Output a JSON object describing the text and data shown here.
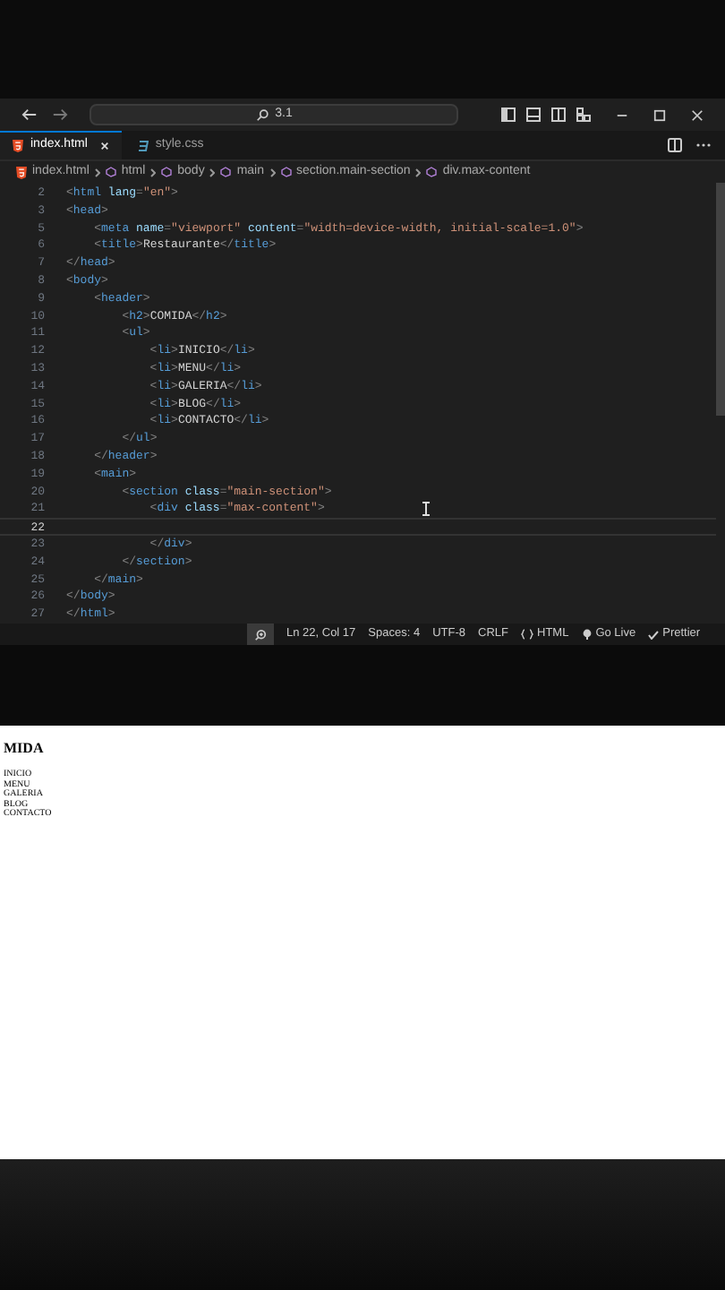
{
  "title_bar": {
    "search": "3.1"
  },
  "tabs": [
    {
      "label": "index.html",
      "kind": "html",
      "selected": true
    },
    {
      "label": "style.css",
      "kind": "css",
      "selected": false
    }
  ],
  "breadcrumb": [
    {
      "label": "index.html",
      "kind": "file"
    },
    {
      "label": "html",
      "kind": "element"
    },
    {
      "label": "body",
      "kind": "element"
    },
    {
      "label": "main",
      "kind": "element"
    },
    {
      "label": "section.main-section",
      "kind": "element"
    },
    {
      "label": "div.max-content",
      "kind": "element"
    }
  ],
  "code_lines": [
    {
      "number": "2",
      "current": false,
      "tokens": [
        {
          "kind": "punct",
          "text": "<"
        },
        {
          "kind": "tag",
          "text": "html"
        },
        {
          "kind": "attr",
          "text": " lang"
        },
        {
          "kind": "punct",
          "text": "="
        },
        {
          "kind": "str",
          "text": "\"en\""
        },
        {
          "kind": "punct",
          "text": ">"
        }
      ]
    },
    {
      "number": "3",
      "current": false,
      "tokens": [
        {
          "kind": "punct",
          "text": "<"
        },
        {
          "kind": "tag",
          "text": "head"
        },
        {
          "kind": "punct",
          "text": ">"
        }
      ]
    },
    {
      "number": "5",
      "current": false,
      "tokens": [
        {
          "kind": "punct",
          "text": "    <"
        },
        {
          "kind": "tag",
          "text": "meta"
        },
        {
          "kind": "attr",
          "text": " name"
        },
        {
          "kind": "punct",
          "text": "="
        },
        {
          "kind": "str",
          "text": "\"viewport\""
        },
        {
          "kind": "attr",
          "text": " content"
        },
        {
          "kind": "punct",
          "text": "="
        },
        {
          "kind": "str",
          "text": "\"width=device-width, initial-scale=1.0\""
        },
        {
          "kind": "punct",
          "text": ">"
        }
      ]
    },
    {
      "number": "6",
      "current": false,
      "tokens": [
        {
          "kind": "punct",
          "text": "    <"
        },
        {
          "kind": "tag",
          "text": "title"
        },
        {
          "kind": "punct",
          "text": ">"
        },
        {
          "kind": "text",
          "text": "Restaurante"
        },
        {
          "kind": "punct",
          "text": "</"
        },
        {
          "kind": "tag",
          "text": "title"
        },
        {
          "kind": "punct",
          "text": ">"
        }
      ]
    },
    {
      "number": "7",
      "current": false,
      "tokens": [
        {
          "kind": "punct",
          "text": "</"
        },
        {
          "kind": "tag",
          "text": "head"
        },
        {
          "kind": "punct",
          "text": ">"
        }
      ]
    },
    {
      "number": "8",
      "current": false,
      "tokens": [
        {
          "kind": "punct",
          "text": "<"
        },
        {
          "kind": "tag",
          "text": "body"
        },
        {
          "kind": "punct",
          "text": ">"
        }
      ]
    },
    {
      "number": "9",
      "current": false,
      "tokens": [
        {
          "kind": "punct",
          "text": "    <"
        },
        {
          "kind": "tag",
          "text": "header"
        },
        {
          "kind": "punct",
          "text": ">"
        }
      ]
    },
    {
      "number": "10",
      "current": false,
      "tokens": [
        {
          "kind": "punct",
          "text": "        <"
        },
        {
          "kind": "tag",
          "text": "h2"
        },
        {
          "kind": "punct",
          "text": ">"
        },
        {
          "kind": "text",
          "text": "COMIDA"
        },
        {
          "kind": "punct",
          "text": "</"
        },
        {
          "kind": "tag",
          "text": "h2"
        },
        {
          "kind": "punct",
          "text": ">"
        }
      ]
    },
    {
      "number": "11",
      "current": false,
      "tokens": [
        {
          "kind": "punct",
          "text": "        <"
        },
        {
          "kind": "tag",
          "text": "ul"
        },
        {
          "kind": "punct",
          "text": ">"
        }
      ]
    },
    {
      "number": "12",
      "current": false,
      "tokens": [
        {
          "kind": "punct",
          "text": "            <"
        },
        {
          "kind": "tag",
          "text": "li"
        },
        {
          "kind": "punct",
          "text": ">"
        },
        {
          "kind": "text",
          "text": "INICIO"
        },
        {
          "kind": "punct",
          "text": "</"
        },
        {
          "kind": "tag",
          "text": "li"
        },
        {
          "kind": "punct",
          "text": ">"
        }
      ]
    },
    {
      "number": "13",
      "current": false,
      "tokens": [
        {
          "kind": "punct",
          "text": "            <"
        },
        {
          "kind": "tag",
          "text": "li"
        },
        {
          "kind": "punct",
          "text": ">"
        },
        {
          "kind": "text",
          "text": "MENU"
        },
        {
          "kind": "punct",
          "text": "</"
        },
        {
          "kind": "tag",
          "text": "li"
        },
        {
          "kind": "punct",
          "text": ">"
        }
      ]
    },
    {
      "number": "14",
      "current": false,
      "tokens": [
        {
          "kind": "punct",
          "text": "            <"
        },
        {
          "kind": "tag",
          "text": "li"
        },
        {
          "kind": "punct",
          "text": ">"
        },
        {
          "kind": "text",
          "text": "GALERIA"
        },
        {
          "kind": "punct",
          "text": "</"
        },
        {
          "kind": "tag",
          "text": "li"
        },
        {
          "kind": "punct",
          "text": ">"
        }
      ]
    },
    {
      "number": "15",
      "current": false,
      "tokens": [
        {
          "kind": "punct",
          "text": "            <"
        },
        {
          "kind": "tag",
          "text": "li"
        },
        {
          "kind": "punct",
          "text": ">"
        },
        {
          "kind": "text",
          "text": "BLOG"
        },
        {
          "kind": "punct",
          "text": "</"
        },
        {
          "kind": "tag",
          "text": "li"
        },
        {
          "kind": "punct",
          "text": ">"
        }
      ]
    },
    {
      "number": "16",
      "current": false,
      "tokens": [
        {
          "kind": "punct",
          "text": "            <"
        },
        {
          "kind": "tag",
          "text": "li"
        },
        {
          "kind": "punct",
          "text": ">"
        },
        {
          "kind": "text",
          "text": "CONTACTO"
        },
        {
          "kind": "punct",
          "text": "</"
        },
        {
          "kind": "tag",
          "text": "li"
        },
        {
          "kind": "punct",
          "text": ">"
        }
      ]
    },
    {
      "number": "17",
      "current": false,
      "tokens": [
        {
          "kind": "punct",
          "text": "        </"
        },
        {
          "kind": "tag",
          "text": "ul"
        },
        {
          "kind": "punct",
          "text": ">"
        }
      ]
    },
    {
      "number": "18",
      "current": false,
      "tokens": [
        {
          "kind": "punct",
          "text": "    </"
        },
        {
          "kind": "tag",
          "text": "header"
        },
        {
          "kind": "punct",
          "text": ">"
        }
      ]
    },
    {
      "number": "19",
      "current": false,
      "tokens": [
        {
          "kind": "punct",
          "text": "    <"
        },
        {
          "kind": "tag",
          "text": "main"
        },
        {
          "kind": "punct",
          "text": ">"
        }
      ]
    },
    {
      "number": "20",
      "current": false,
      "tokens": [
        {
          "kind": "punct",
          "text": "        <"
        },
        {
          "kind": "tag",
          "text": "section"
        },
        {
          "kind": "attr",
          "text": " class"
        },
        {
          "kind": "punct",
          "text": "="
        },
        {
          "kind": "str",
          "text": "\"main-section\""
        },
        {
          "kind": "punct",
          "text": ">"
        }
      ]
    },
    {
      "number": "21",
      "current": false,
      "tokens": [
        {
          "kind": "punct",
          "text": "            <"
        },
        {
          "kind": "tag",
          "text": "div"
        },
        {
          "kind": "attr",
          "text": " class"
        },
        {
          "kind": "punct",
          "text": "="
        },
        {
          "kind": "str",
          "text": "\"max-content\""
        },
        {
          "kind": "punct",
          "text": ">"
        }
      ]
    },
    {
      "number": "22",
      "current": true
    },
    {
      "number": "23",
      "current": false,
      "tokens": [
        {
          "kind": "punct",
          "text": "            </"
        },
        {
          "kind": "tag",
          "text": "div"
        },
        {
          "kind": "punct",
          "text": ">"
        }
      ]
    },
    {
      "number": "24",
      "current": false,
      "tokens": [
        {
          "kind": "punct",
          "text": "        </"
        },
        {
          "kind": "tag",
          "text": "section"
        },
        {
          "kind": "punct",
          "text": ">"
        }
      ]
    },
    {
      "number": "25",
      "current": false,
      "tokens": [
        {
          "kind": "punct",
          "text": "    </"
        },
        {
          "kind": "tag",
          "text": "main"
        },
        {
          "kind": "punct",
          "text": ">"
        }
      ]
    },
    {
      "number": "26",
      "current": false,
      "tokens": [
        {
          "kind": "punct",
          "text": "</"
        },
        {
          "kind": "tag",
          "text": "body"
        },
        {
          "kind": "punct",
          "text": ">"
        }
      ]
    },
    {
      "number": "27",
      "current": false,
      "tokens": [
        {
          "kind": "punct",
          "text": "</"
        },
        {
          "kind": "tag",
          "text": "html"
        },
        {
          "kind": "punct",
          "text": ">"
        }
      ]
    }
  ],
  "status_bar": [
    {
      "label": "Ln 22, Col 17",
      "kind": "text"
    },
    {
      "label": "Spaces: 4",
      "kind": "text"
    },
    {
      "label": "UTF-8",
      "kind": "text"
    },
    {
      "label": "CRLF",
      "kind": "text"
    },
    {
      "label": "HTML",
      "kind": "language"
    },
    {
      "label": "Go Live",
      "kind": "live"
    },
    {
      "label": "Prettier",
      "kind": "check"
    }
  ],
  "preview": {
    "heading": "MIDA",
    "items": [
      "INICIO",
      "MENU",
      "GALERIA",
      "BLOG",
      "CONTACTO"
    ]
  }
}
